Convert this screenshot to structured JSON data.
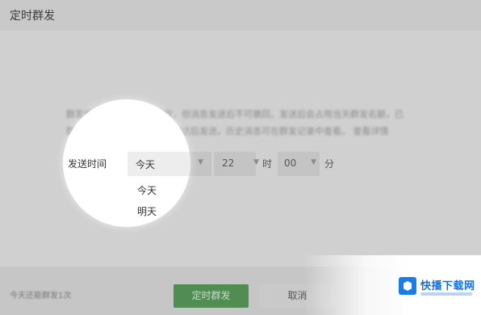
{
  "header": {
    "title": "定时群发"
  },
  "description": {
    "line1": "群发的消息可在发送前修改，但消息发送后不可撤回，发送后会占用当天群发名额，已",
    "line2": "群发的定时消息在发送时间到达后发送，历史消息可在群发记录中查看。",
    "learn_more": "查看详情"
  },
  "form": {
    "send_time_label": "发送时间",
    "day_value": "今天",
    "hour_value": "22",
    "hour_unit": "时",
    "minute_value": "00",
    "minute_unit": "分",
    "dropdown_options": [
      "今天",
      "明天"
    ]
  },
  "footer": {
    "note": "今天还能群发1次",
    "confirm_label": "定时群发",
    "cancel_label": "取消"
  },
  "watermark": {
    "text": "快播下载网"
  },
  "colors": {
    "primary_button": "#4f8d53",
    "brand_blue": "#1a7de6"
  }
}
